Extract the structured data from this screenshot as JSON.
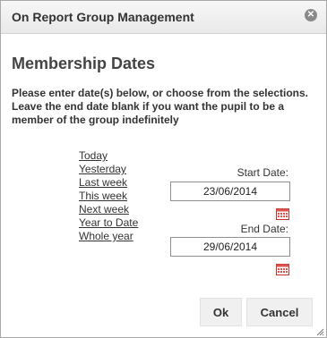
{
  "dialog": {
    "title": "On Report Group Management",
    "close_icon": "close-icon"
  },
  "main": {
    "heading": "Membership Dates",
    "instructions": "Please enter date(s) below, or choose from the selections. Leave the end date blank if you want the pupil to be a member of the group indefinitely"
  },
  "quick_links": [
    "Today",
    "Yesterday",
    "Last week",
    "This week",
    "Next week",
    "Year to Date",
    "Whole year"
  ],
  "start": {
    "label": "Start Date:",
    "value": "23/06/2014",
    "icon": "calendar-icon"
  },
  "end": {
    "label": "End Date:",
    "value": "29/06/2014",
    "icon": "calendar-icon"
  },
  "buttons": {
    "ok": "Ok",
    "cancel": "Cancel"
  },
  "colors": {
    "calendar_accent": "#d9534f",
    "titlebar_bg": "#efefef",
    "button_bg": "#f0f0f0"
  }
}
